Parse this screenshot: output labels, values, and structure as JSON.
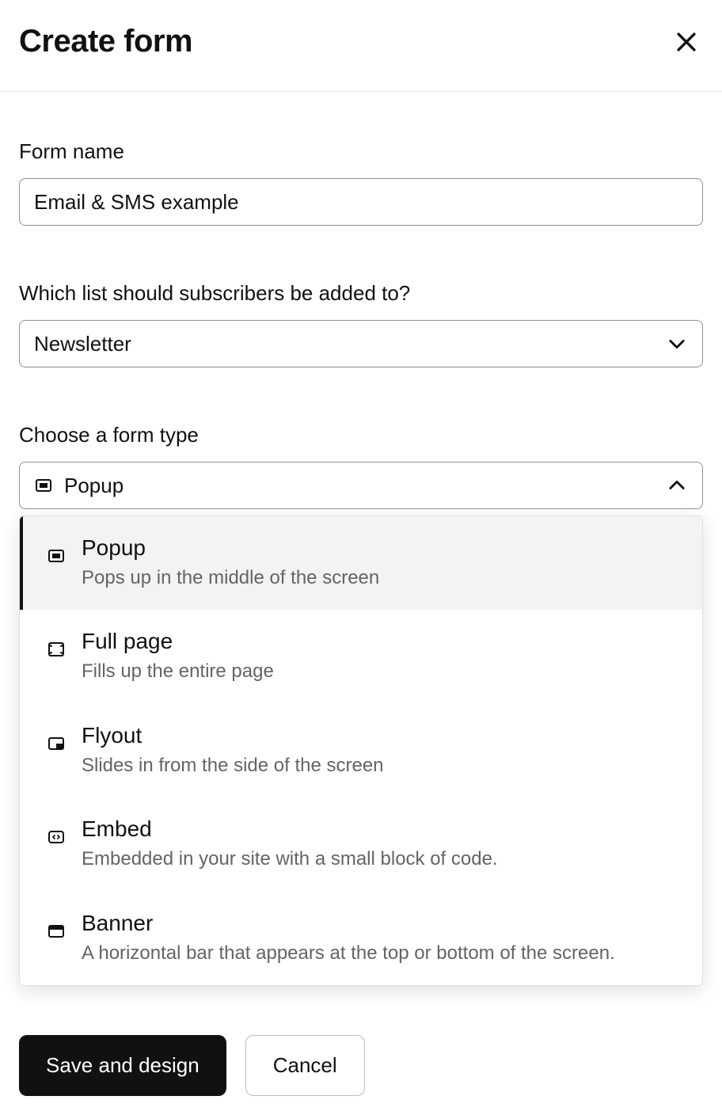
{
  "header": {
    "title": "Create form"
  },
  "formName": {
    "label": "Form name",
    "value": "Email & SMS example"
  },
  "listSelect": {
    "label": "Which list should subscribers be added to?",
    "selected": "Newsletter"
  },
  "formType": {
    "label": "Choose a form type",
    "selected": "Popup",
    "options": [
      {
        "icon": "popup",
        "title": "Popup",
        "desc": "Pops up in the middle of the screen",
        "active": true
      },
      {
        "icon": "fullpage",
        "title": "Full page",
        "desc": "Fills up the entire page",
        "active": false
      },
      {
        "icon": "flyout",
        "title": "Flyout",
        "desc": "Slides in from the side of the screen",
        "active": false
      },
      {
        "icon": "embed",
        "title": "Embed",
        "desc": "Embedded in your site with a small block of code.",
        "active": false
      },
      {
        "icon": "banner",
        "title": "Banner",
        "desc": "A horizontal bar that appears at the top or bottom of the screen.",
        "active": false
      }
    ]
  },
  "footer": {
    "save": "Save and design",
    "cancel": "Cancel"
  }
}
